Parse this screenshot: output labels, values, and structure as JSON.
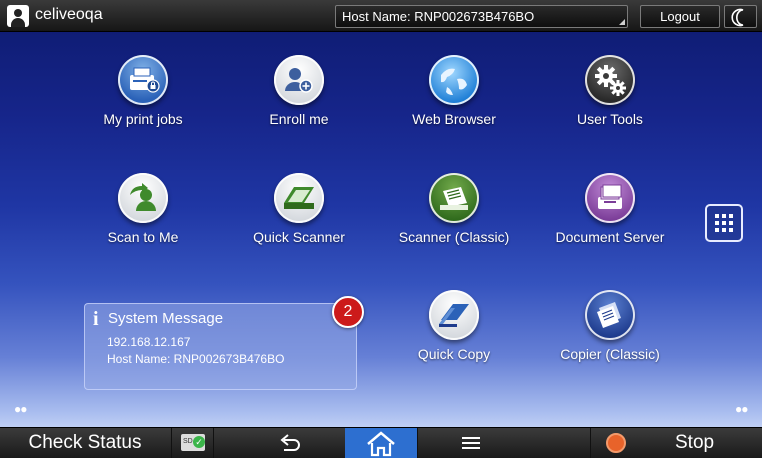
{
  "topbar": {
    "username": "celiveoqa",
    "host_field": "Host Name: RNP002673B476BO",
    "logout_label": "Logout"
  },
  "apps": [
    {
      "label": "My print jobs",
      "icon": "print-jobs-icon"
    },
    {
      "label": "Enroll me",
      "icon": "enroll-user-icon"
    },
    {
      "label": "Web Browser",
      "icon": "globe-icon"
    },
    {
      "label": "User Tools",
      "icon": "gears-icon"
    },
    {
      "label": "Scan to Me",
      "icon": "scan-to-me-icon"
    },
    {
      "label": "Quick Scanner",
      "icon": "quick-scanner-icon"
    },
    {
      "label": "Scanner (Classic)",
      "icon": "scanner-classic-icon"
    },
    {
      "label": "Document Server",
      "icon": "document-server-icon"
    },
    {
      "label": "Quick Copy",
      "icon": "quick-copy-icon"
    },
    {
      "label": "Copier (Classic)",
      "icon": "copier-classic-icon"
    }
  ],
  "system_message": {
    "title": "System Message",
    "ip": "192.168.12.167",
    "host": "Host Name: RNP002673B476BO",
    "badge_count": "2"
  },
  "bottombar": {
    "check_status": "Check Status",
    "stop": "Stop"
  },
  "colors": {
    "home_active": "#2d6fd0",
    "badge": "#cc1a1a",
    "stop": "#e8632a"
  }
}
